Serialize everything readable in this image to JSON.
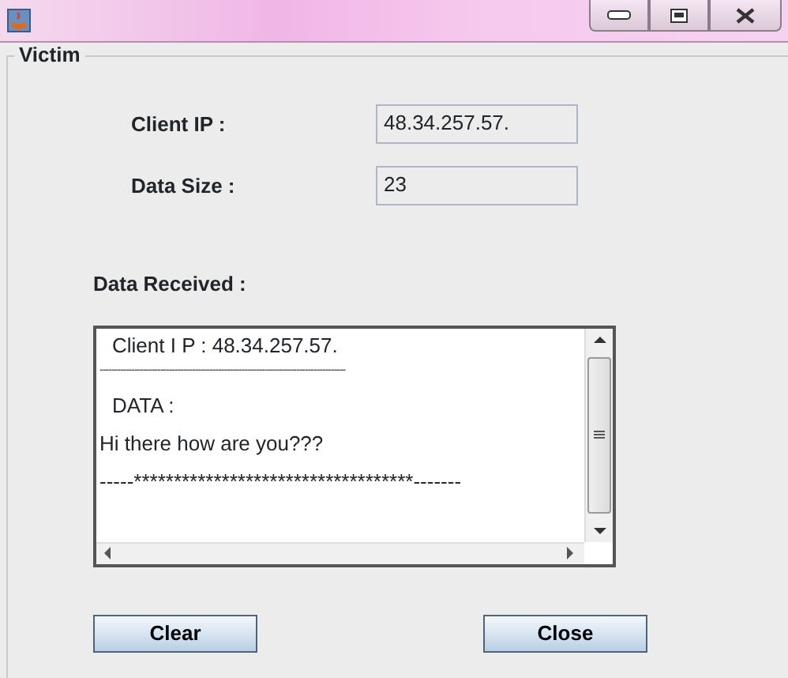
{
  "group": {
    "title": "Victim"
  },
  "fields": [
    {
      "label": "Client IP :",
      "value": "48.34.257.57."
    },
    {
      "label": "Data Size :",
      "value": "23"
    }
  ],
  "received": {
    "label": "Data Received :",
    "lines": [
      {
        "kind": "indent",
        "text": "Client I P  :  48.34.257.57."
      },
      {
        "kind": "rule",
        "text": "-------------------------------------------------------------------------------------"
      },
      {
        "kind": "indent",
        "text": "DATA  :"
      },
      {
        "kind": "plain",
        "text": "Hi there how are you???"
      },
      {
        "kind": "plain",
        "text": "-----***********************************-------"
      }
    ]
  },
  "buttons": [
    "Clear",
    "Close"
  ]
}
